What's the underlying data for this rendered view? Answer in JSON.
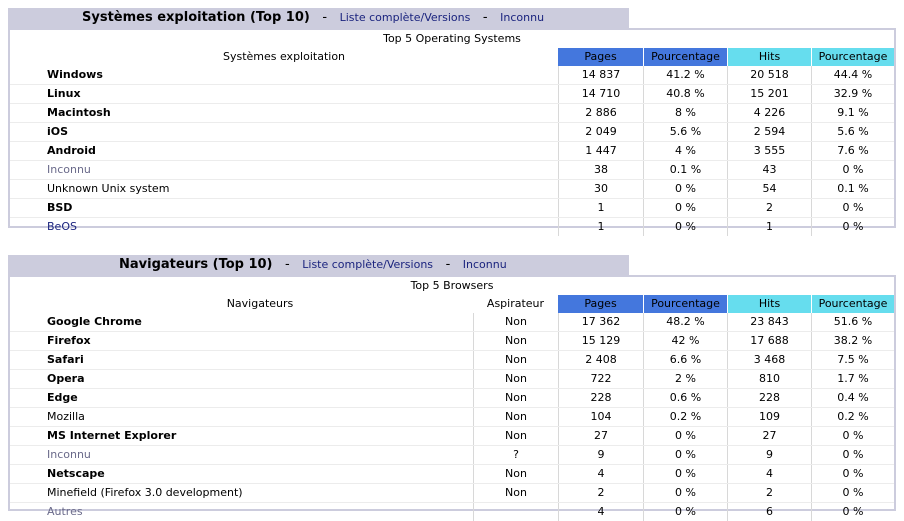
{
  "os": {
    "title": "Systèmes exploitation (Top 10)",
    "sep1": "-",
    "link_full": "Liste complète/Versions",
    "sep2": "-",
    "link_unknown": "Inconnu",
    "top_label": "Top 5 Operating Systems",
    "headers": {
      "name": "Systèmes exploitation",
      "pages": "Pages",
      "pct1": "Pourcentage",
      "hits": "Hits",
      "pct2": "Pourcentage"
    },
    "colors": {
      "pages": "#4477dd",
      "hits": "#66ddee"
    },
    "rows": [
      {
        "name": "Windows",
        "pages": "14 837",
        "pct1": "41.2 %",
        "hits": "20 518",
        "pct2": "44.4 %"
      },
      {
        "name": "Linux",
        "pages": "14 710",
        "pct1": "40.8 %",
        "hits": "15 201",
        "pct2": "32.9 %"
      },
      {
        "name": "Macintosh",
        "pages": "2 886",
        "pct1": "8 %",
        "hits": "4 226",
        "pct2": "9.1 %"
      },
      {
        "name": "iOS",
        "pages": "2 049",
        "pct1": "5.6 %",
        "hits": "2 594",
        "pct2": "5.6 %"
      },
      {
        "name": "Android",
        "pages": "1 447",
        "pct1": "4 %",
        "hits": "3 555",
        "pct2": "7.6 %"
      },
      {
        "name": "Inconnu",
        "pages": "38",
        "pct1": "0.1 %",
        "hits": "43",
        "pct2": "0 %"
      },
      {
        "name": "Unknown Unix system",
        "pages": "30",
        "pct1": "0 %",
        "hits": "54",
        "pct2": "0.1 %"
      },
      {
        "name": "BSD",
        "pages": "1",
        "pct1": "0 %",
        "hits": "2",
        "pct2": "0 %"
      },
      {
        "name": "BeOS",
        "pages": "1",
        "pct1": "0 %",
        "hits": "1",
        "pct2": "0 %"
      }
    ]
  },
  "browsers": {
    "title": "Navigateurs (Top 10)",
    "sep1": "-",
    "link_full": "Liste complète/Versions",
    "sep2": "-",
    "link_unknown": "Inconnu",
    "top_label": "Top 5 Browsers",
    "headers": {
      "name": "Navigateurs",
      "aspirateur": "Aspirateur",
      "pages": "Pages",
      "pct1": "Pourcentage",
      "hits": "Hits",
      "pct2": "Pourcentage"
    },
    "rows": [
      {
        "name": "Google Chrome",
        "asp": "Non",
        "pages": "17 362",
        "pct1": "48.2 %",
        "hits": "23 843",
        "pct2": "51.6 %"
      },
      {
        "name": "Firefox",
        "asp": "Non",
        "pages": "15 129",
        "pct1": "42 %",
        "hits": "17 688",
        "pct2": "38.2 %"
      },
      {
        "name": "Safari",
        "asp": "Non",
        "pages": "2 408",
        "pct1": "6.6 %",
        "hits": "3 468",
        "pct2": "7.5 %"
      },
      {
        "name": "Opera",
        "asp": "Non",
        "pages": "722",
        "pct1": "2 %",
        "hits": "810",
        "pct2": "1.7 %"
      },
      {
        "name": "Edge",
        "asp": "Non",
        "pages": "228",
        "pct1": "0.6 %",
        "hits": "228",
        "pct2": "0.4 %"
      },
      {
        "name": "Mozilla",
        "asp": "Non",
        "pages": "104",
        "pct1": "0.2 %",
        "hits": "109",
        "pct2": "0.2 %"
      },
      {
        "name": "MS Internet Explorer",
        "asp": "Non",
        "pages": "27",
        "pct1": "0 %",
        "hits": "27",
        "pct2": "0 %"
      },
      {
        "name": "Inconnu",
        "asp": "?",
        "pages": "9",
        "pct1": "0 %",
        "hits": "9",
        "pct2": "0 %"
      },
      {
        "name": "Netscape",
        "asp": "Non",
        "pages": "4",
        "pct1": "0 %",
        "hits": "4",
        "pct2": "0 %"
      },
      {
        "name": "Minefield (Firefox 3.0 development)",
        "asp": "Non",
        "pages": "2",
        "pct1": "0 %",
        "hits": "2",
        "pct2": "0 %"
      },
      {
        "name": "Autres",
        "asp": "",
        "pages": "4",
        "pct1": "0 %",
        "hits": "6",
        "pct2": "0 %"
      }
    ]
  }
}
